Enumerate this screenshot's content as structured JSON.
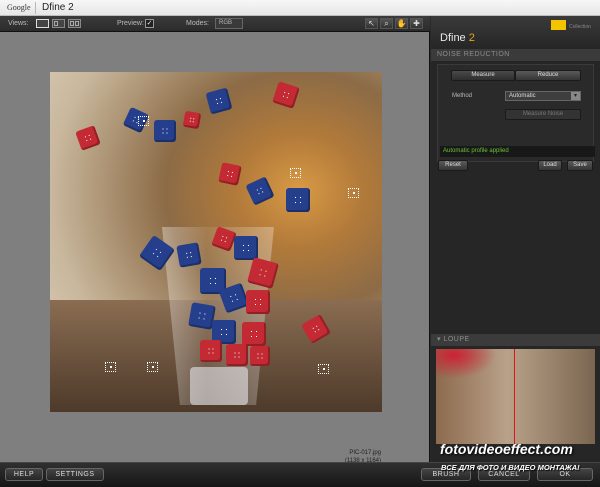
{
  "titlebar": {
    "brand": "Google",
    "title": "Dfine 2"
  },
  "toolbar": {
    "views_label": "Views:",
    "preview_label": "Preview:",
    "preview_checked": "✓",
    "modes_label": "Modes:",
    "modes_value": "RGB",
    "tools": [
      "arrow-tool-icon",
      "zoom-tool-icon",
      "hand-tool-icon",
      "picker-tool-icon"
    ]
  },
  "image": {
    "filename": "PIC-017.jpg",
    "dimensions": "(1138 x 1164)"
  },
  "panel": {
    "title_word": "Dfine",
    "title_num": "2",
    "collection": "Collection",
    "noise_reduction_header": "NOISE REDUCTION",
    "measure_label": "Measure",
    "reduce_label": "Reduce",
    "method_label": "Method",
    "method_value": "Automatic",
    "measure_noise_label": "Measure Noise",
    "status": "Automatic profile applied",
    "reset_label": "Reset",
    "load_label": "Load",
    "save_label": "Save",
    "loupe_header": "LOUPE"
  },
  "bottom": {
    "help_label": "HELP",
    "settings_label": "SETTINGS",
    "brush_label": "BRUSH",
    "cancel_label": "CANCEL",
    "ok_label": "OK"
  },
  "watermark": {
    "line1": "fotovideoeffect.com",
    "line2": "ВСЕ ДЛЯ ФОТО И ВИДЕО МОНТАЖА!"
  },
  "colors": {
    "accent": "#e2a51a",
    "status_green": "#68c431",
    "loupe_line": "#e01515"
  }
}
